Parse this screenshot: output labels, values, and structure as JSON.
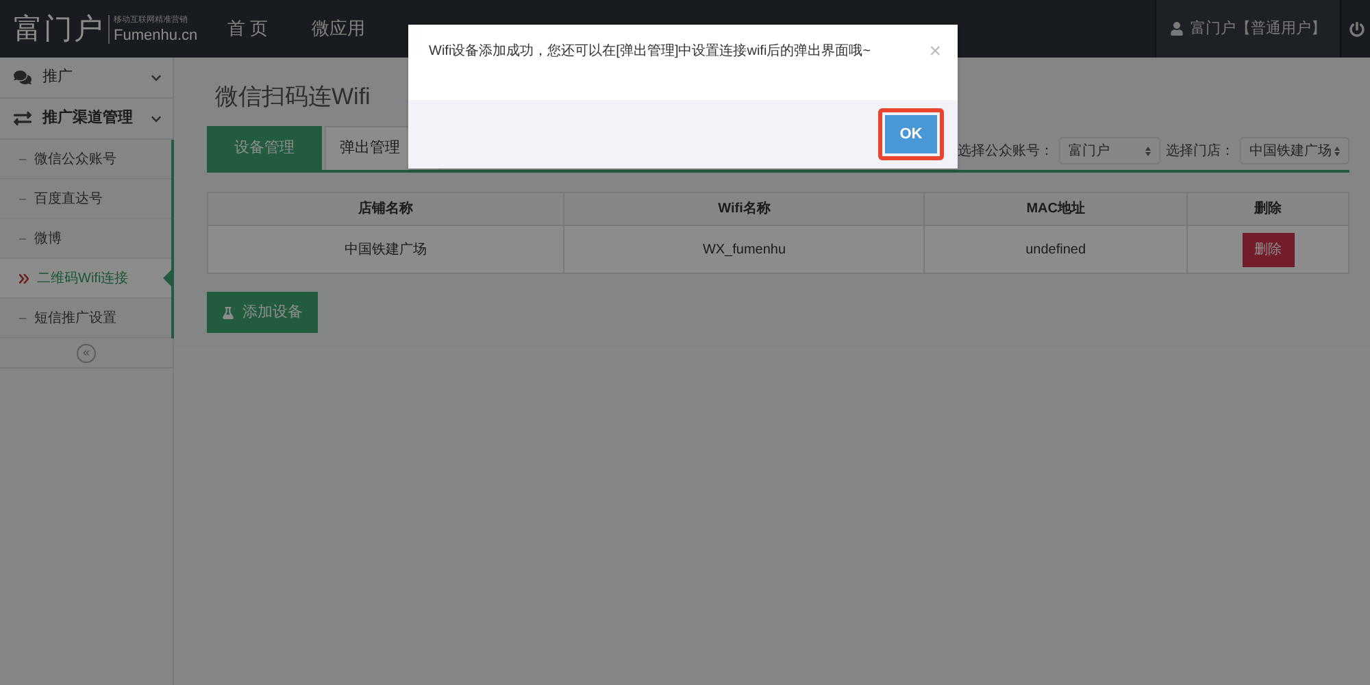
{
  "header": {
    "logo": "富门户",
    "slogan": "移动互联网精准营销",
    "domain": "Fumenhu.cn",
    "nav": [
      {
        "label": "首 页"
      },
      {
        "label": "微应用"
      }
    ],
    "user": "富门户【普通用户】"
  },
  "sidebar": {
    "groups": [
      {
        "label": "推广"
      },
      {
        "label": "推广渠道管理",
        "children": [
          {
            "label": "微信公众账号",
            "selected": false
          },
          {
            "label": "百度直达号",
            "selected": false
          },
          {
            "label": "微博",
            "selected": false
          },
          {
            "label": "二维码Wifi连接",
            "selected": true
          },
          {
            "label": "短信推广设置",
            "selected": false
          }
        ]
      }
    ],
    "collapse": "«"
  },
  "page": {
    "title": "微信扫码连Wifi",
    "tabs": [
      {
        "label": "设备管理",
        "selected": true
      },
      {
        "label": "弹出管理",
        "selected": false
      }
    ],
    "filters": [
      {
        "label": "选择公众账号：",
        "value": "富门户"
      },
      {
        "label": "选择门店：",
        "value": "中国铁建广场"
      }
    ],
    "table": {
      "columns": [
        "店铺名称",
        "Wifi名称",
        "MAC地址",
        "删除"
      ],
      "rows": [
        {
          "cells": [
            "中国铁建广场",
            "WX_fumenhu",
            "undefined"
          ],
          "action": "删除"
        }
      ]
    },
    "add_button": "添加设备"
  },
  "dialog": {
    "message": "Wifi设备添加成功，您还可以在[弹出管理]中设置连接wifi后的弹出界面哦~",
    "close": "×",
    "ok": "OK"
  }
}
